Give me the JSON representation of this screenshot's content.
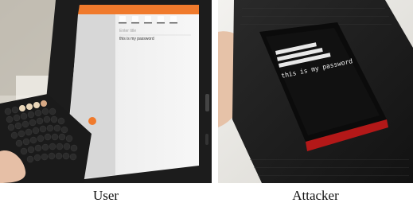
{
  "figure": {
    "panels": [
      {
        "caption": "User",
        "tablet": {
          "title_placeholder": "Enter title",
          "body_text": "this is my password"
        }
      },
      {
        "caption": "Attacker",
        "screen": {
          "line1": "this is my password"
        }
      }
    ]
  }
}
